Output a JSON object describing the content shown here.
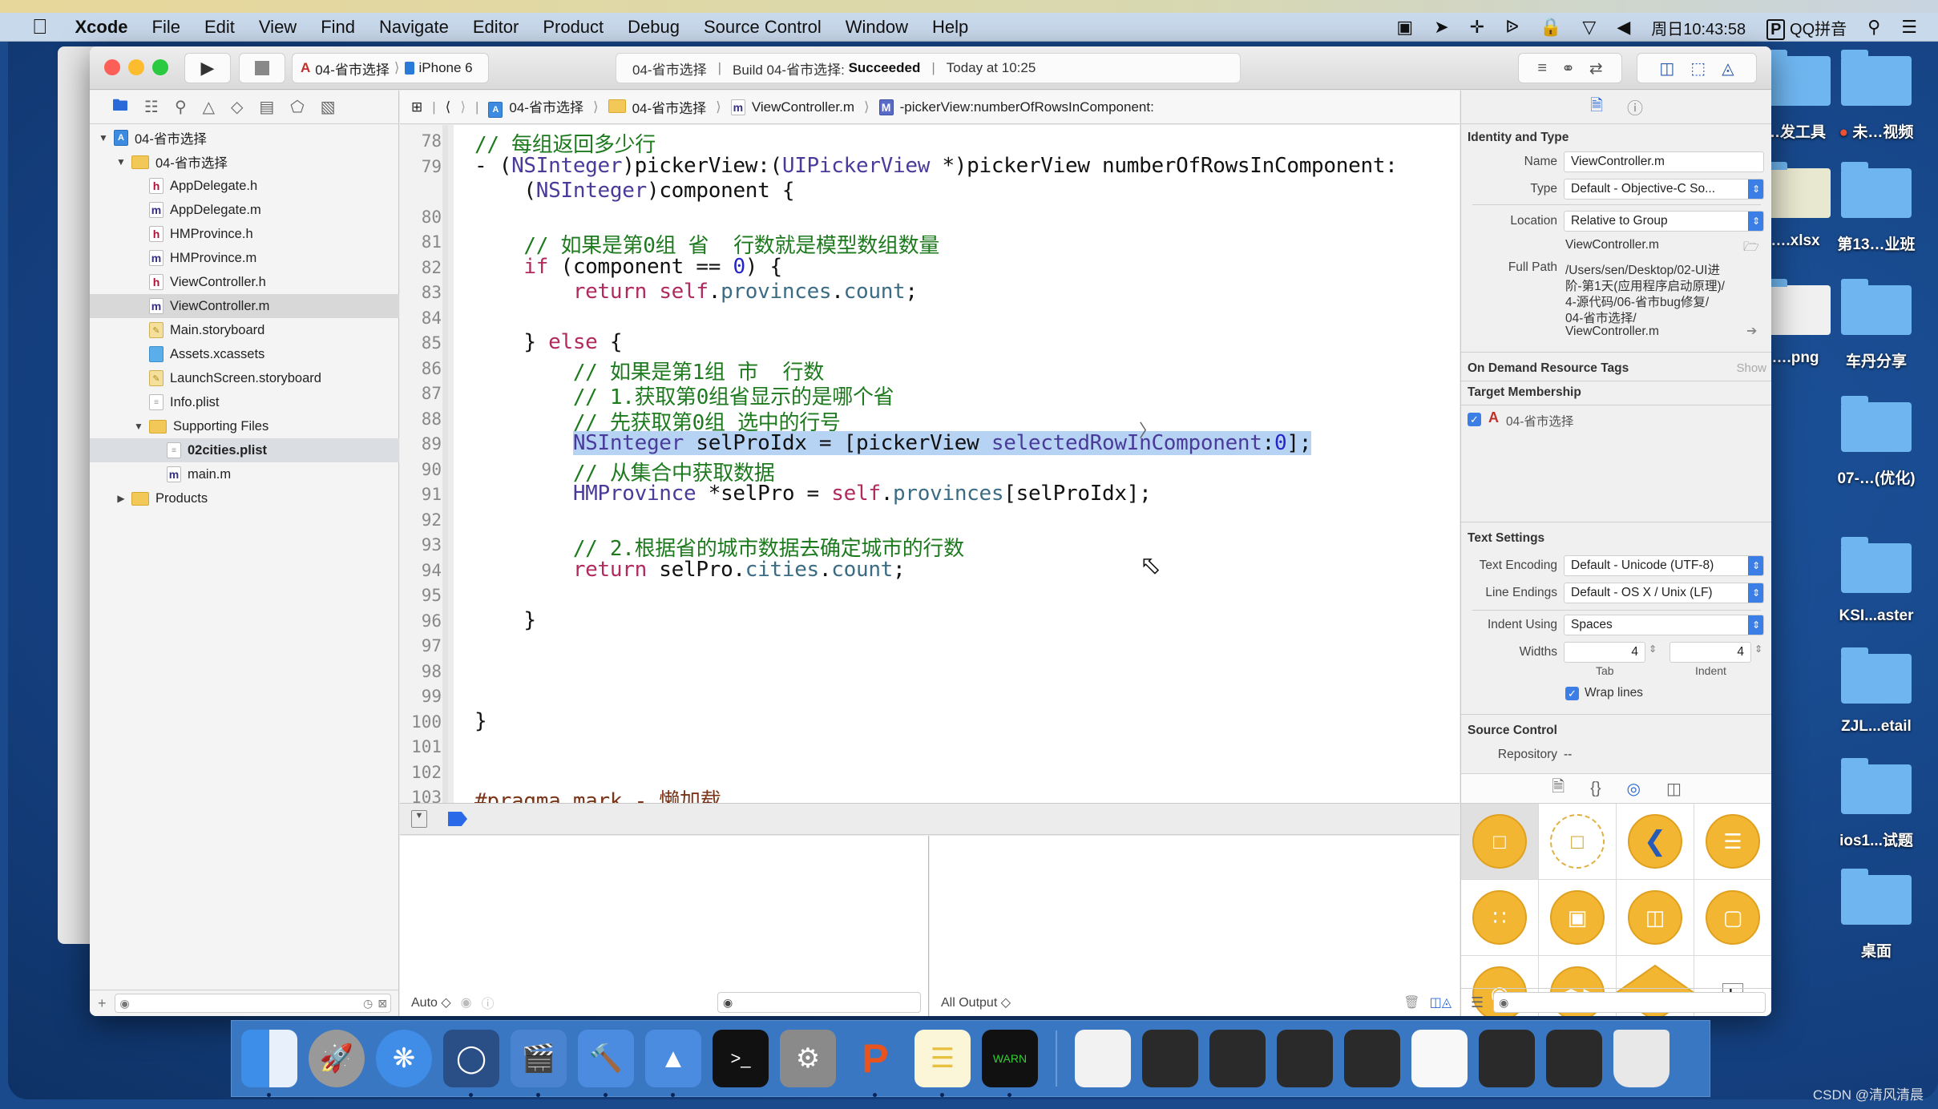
{
  "menubar": {
    "app_name": "Xcode",
    "items": [
      "File",
      "Edit",
      "View",
      "Find",
      "Navigate",
      "Editor",
      "Product",
      "Debug",
      "Source Control",
      "Window",
      "Help"
    ],
    "clock": "周日10:43:58",
    "input_method": "QQ拼音"
  },
  "toolbar": {
    "scheme_name": "04-省市选择",
    "device": "iPhone 6",
    "activity": {
      "project": "04-省市选择",
      "build_prefix": "Build 04-省市选择:",
      "build_status": "Succeeded",
      "time": "Today at 10:25"
    }
  },
  "navigator": {
    "items": [
      {
        "label": "04-省市选择",
        "type": "proj",
        "level": 0,
        "disclosure": "open"
      },
      {
        "label": "04-省市选择",
        "type": "folder",
        "level": 1,
        "disclosure": "open"
      },
      {
        "label": "AppDelegate.h",
        "type": "h",
        "level": 2
      },
      {
        "label": "AppDelegate.m",
        "type": "m",
        "level": 2
      },
      {
        "label": "HMProvince.h",
        "type": "h",
        "level": 2
      },
      {
        "label": "HMProvince.m",
        "type": "m",
        "level": 2
      },
      {
        "label": "ViewController.h",
        "type": "h",
        "level": 2
      },
      {
        "label": "ViewController.m",
        "type": "m",
        "level": 2,
        "selected": true
      },
      {
        "label": "Main.storyboard",
        "type": "sb",
        "level": 2
      },
      {
        "label": "Assets.xcassets",
        "type": "xc",
        "level": 2
      },
      {
        "label": "LaunchScreen.storyboard",
        "type": "sb",
        "level": 2
      },
      {
        "label": "Info.plist",
        "type": "pl",
        "level": 2
      },
      {
        "label": "Supporting Files",
        "type": "folder",
        "level": 2,
        "disclosure": "open"
      },
      {
        "label": "02cities.plist",
        "type": "pl",
        "level": 3,
        "highlighted": true
      },
      {
        "label": "main.m",
        "type": "m",
        "level": 3
      },
      {
        "label": "Products",
        "type": "folder",
        "level": 1,
        "disclosure": "closed"
      }
    ]
  },
  "jumpbar": {
    "crumbs": [
      "04-省市选择",
      "04-省市选择",
      "ViewController.m",
      "-pickerView:numberOfRowsInComponent:"
    ]
  },
  "editor": {
    "lines": [
      {
        "n": "78",
        "code": [
          [
            "c-com",
            "// 每组返回多少行"
          ]
        ]
      },
      {
        "n": "79",
        "code": [
          [
            "",
            "- ("
          ],
          [
            "c-type",
            "NSInteger"
          ],
          [
            "",
            ")pickerView:("
          ],
          [
            "c-type",
            "UIPickerView"
          ],
          [
            "",
            " *)pickerView numberOfRowsInComponent:"
          ]
        ]
      },
      {
        "n": "",
        "code": [
          [
            "",
            "    ("
          ],
          [
            "c-type",
            "NSInteger"
          ],
          [
            "",
            ")component {"
          ]
        ]
      },
      {
        "n": "80",
        "code": []
      },
      {
        "n": "81",
        "code": [
          [
            "c-com",
            "    // 如果是第0组 省  行数就是模型数组数量"
          ]
        ]
      },
      {
        "n": "82",
        "code": [
          [
            "c-kw",
            "    if"
          ],
          [
            "",
            " (component == "
          ],
          [
            "c-num",
            "0"
          ],
          [
            "",
            ") {"
          ]
        ]
      },
      {
        "n": "83",
        "code": [
          [
            "c-kw",
            "        return"
          ],
          [
            "",
            " "
          ],
          [
            "c-kw",
            "self"
          ],
          [
            "",
            "."
          ],
          [
            "c-prop",
            "provinces"
          ],
          [
            "",
            "."
          ],
          [
            "c-prop",
            "count"
          ],
          [
            "",
            ";"
          ]
        ]
      },
      {
        "n": "84",
        "code": []
      },
      {
        "n": "85",
        "code": [
          [
            "",
            "    } "
          ],
          [
            "c-kw",
            "else"
          ],
          [
            "",
            " {"
          ]
        ]
      },
      {
        "n": "86",
        "code": [
          [
            "c-com",
            "        // 如果是第1组 市  行数"
          ]
        ]
      },
      {
        "n": "87",
        "code": [
          [
            "c-com",
            "        // 1.获取第0组省显示的是哪个省"
          ]
        ]
      },
      {
        "n": "88",
        "code": [
          [
            "c-com",
            "        // 先获取第0组 选中的行号"
          ]
        ]
      },
      {
        "n": "89",
        "highlight": true,
        "code": [
          [
            "",
            "        "
          ],
          [
            "c-type",
            "NSInteger"
          ],
          [
            "",
            " selProIdx = [pickerView "
          ],
          [
            "c-type",
            "selectedRowInComponent"
          ],
          [
            "",
            ":"
          ],
          [
            "c-num",
            "0"
          ],
          [
            "",
            "];"
          ]
        ]
      },
      {
        "n": "90",
        "code": [
          [
            "c-com",
            "        // 从集合中获取数据"
          ]
        ]
      },
      {
        "n": "91",
        "code": [
          [
            "c-type",
            "        HMProvince"
          ],
          [
            "",
            " *selPro = "
          ],
          [
            "c-kw",
            "self"
          ],
          [
            "",
            "."
          ],
          [
            "c-prop",
            "provinces"
          ],
          [
            "",
            "[selProIdx];"
          ]
        ]
      },
      {
        "n": "92",
        "code": []
      },
      {
        "n": "93",
        "code": [
          [
            "c-com",
            "        // 2.根据省的城市数据去确定城市的行数"
          ]
        ]
      },
      {
        "n": "94",
        "code": [
          [
            "c-kw",
            "        return"
          ],
          [
            "",
            " selPro."
          ],
          [
            "c-prop",
            "cities"
          ],
          [
            "",
            "."
          ],
          [
            "c-prop",
            "count"
          ],
          [
            "",
            ";"
          ]
        ]
      },
      {
        "n": "95",
        "code": []
      },
      {
        "n": "96",
        "code": [
          [
            "",
            "    }"
          ]
        ]
      },
      {
        "n": "97",
        "code": []
      },
      {
        "n": "98",
        "code": []
      },
      {
        "n": "99",
        "code": []
      },
      {
        "n": "100",
        "code": [
          [
            "",
            "}"
          ]
        ]
      },
      {
        "n": "101",
        "code": []
      },
      {
        "n": "102",
        "code": []
      },
      {
        "n": "103",
        "code": [
          [
            "c-pre",
            "#pragma mark - 懒加载"
          ]
        ]
      }
    ]
  },
  "debug": {
    "vars_mode": "Auto ◇",
    "console_mode": "All Output ◇"
  },
  "inspector": {
    "identity_title": "Identity and Type",
    "name_label": "Name",
    "name_value": "ViewController.m",
    "type_label": "Type",
    "type_value": "Default - Objective-C So...",
    "location_label": "Location",
    "location_value": "Relative to Group",
    "location_file": "ViewController.m",
    "full_path_label": "Full Path",
    "full_path_lines": [
      "/Users/sen/Desktop/02-UI进",
      "阶-第1天(应用程序启动原理)/",
      "4-源代码/06-省市bug修复/",
      "04-省市选择/",
      "ViewController.m"
    ],
    "odr_title": "On Demand Resource Tags",
    "odr_show": "Show",
    "target_title": "Target Membership",
    "target_name": "04-省市选择",
    "target_checked": true,
    "text_title": "Text Settings",
    "encoding_label": "Text Encoding",
    "encoding_value": "Default - Unicode (UTF-8)",
    "endings_label": "Line Endings",
    "endings_value": "Default - OS X / Unix (LF)",
    "indent_label": "Indent Using",
    "indent_value": "Spaces",
    "widths_label": "Widths",
    "tab_width": "4",
    "indent_width": "4",
    "tab_caption": "Tab",
    "indent_caption": "Indent",
    "wrap_label": "Wrap lines",
    "wrap_checked": true,
    "sc_title": "Source Control",
    "repo_label": "Repository",
    "repo_value": "--"
  },
  "desktop": {
    "icons": [
      {
        "label": "…发工具"
      },
      {
        "label": "未…视频",
        "tag": "red"
      },
      {
        "label": "….xlsx"
      },
      {
        "label": "第13…业班"
      },
      {
        "label": "….png"
      },
      {
        "label": "车丹分享"
      },
      {
        "label": "07-…(优化)"
      },
      {
        "label": "KSI...aster"
      },
      {
        "label": "ZJL...etail"
      },
      {
        "label": "ios1...试题"
      },
      {
        "label": "桌面"
      }
    ]
  },
  "dock": {
    "apps": [
      "Finder",
      "Launchpad",
      "Safari",
      "Mouse",
      "Video Editor",
      "Xcode",
      "Instruments",
      "Terminal",
      "System Preferences",
      "PowerPoint",
      "Notes",
      "Console"
    ],
    "windows": 9
  },
  "watermark": "CSDN @清风清晨"
}
